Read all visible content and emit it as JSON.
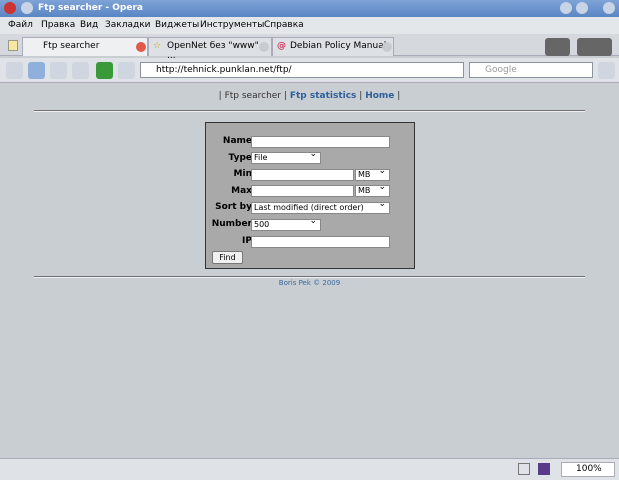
{
  "window": {
    "title": "Ftp searcher - Opera"
  },
  "menu": [
    "Файл",
    "Правка",
    "Вид",
    "Закладки",
    "Виджеты",
    "Инструменты",
    "Справка"
  ],
  "tabs": [
    {
      "label": "Ftp searcher",
      "active": true
    },
    {
      "label": "OpenNet без \"www\" - ..."
    },
    {
      "label": "Debian Policy Manual"
    }
  ],
  "address": {
    "url": "http://tehnick.punklan.net/ftp/",
    "search_placeholder": "Google"
  },
  "nav": {
    "sep": "|",
    "current": "Ftp searcher",
    "links": [
      "Ftp statistics",
      "Home"
    ]
  },
  "form": {
    "labels": {
      "name": "Name",
      "type": "Type",
      "min": "Min",
      "max": "Max",
      "sort": "Sort by",
      "number": "Number",
      "ip": "IP"
    },
    "type_value": "File",
    "min_unit": "MB",
    "max_unit": "MB",
    "sort_value": "Last modified (direct order)",
    "number_value": "500",
    "find": "Find"
  },
  "footer": "Boris Pek © 2009",
  "status": {
    "zoom": "100%"
  }
}
